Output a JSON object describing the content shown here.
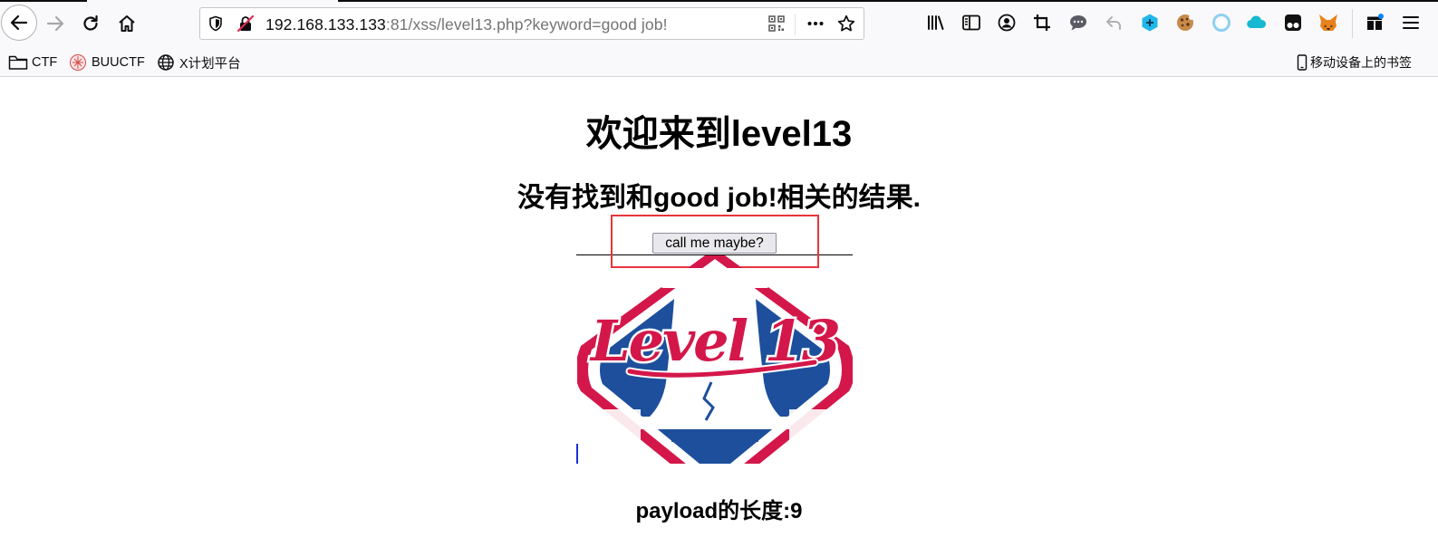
{
  "browser": {
    "url_host": "192.168.133.133",
    "url_rest": ":81/xss/level13.php?keyword=good job!",
    "icons": [
      "back-icon",
      "forward-icon",
      "reload-icon",
      "home-icon",
      "shield-icon",
      "insecure-lock-icon",
      "qr-code-icon",
      "more-icon",
      "bookmark-star-icon",
      "library-icon",
      "sidebar-icon",
      "account-icon",
      "screenshot-crop-icon",
      "chat-icon",
      "undo-icon",
      "extension-cube-icon",
      "cookie-icon",
      "circle-extension-icon",
      "cloud-icon",
      "tampermonkey-icon",
      "metamask-fox-icon",
      "extensions-icon",
      "menu-icon"
    ]
  },
  "bookmarks": {
    "items": [
      {
        "label": "CTF",
        "icon": "folder-icon"
      },
      {
        "label": "BUUCTF",
        "icon": "buuctf-logo-icon"
      },
      {
        "label": "X计划平台",
        "icon": "globe-icon"
      }
    ],
    "mobile_label": "移动设备上的书签"
  },
  "page": {
    "title": "欢迎来到level13",
    "result_text": "没有找到和good job!相关的结果.",
    "button_label": "call me maybe?",
    "logo_text": "Level 13",
    "payload_text": "payload的长度:9"
  },
  "colors": {
    "logo_red": "#d4174a",
    "logo_blue": "#1d4f9c",
    "highlight_red": "#e8363c"
  }
}
